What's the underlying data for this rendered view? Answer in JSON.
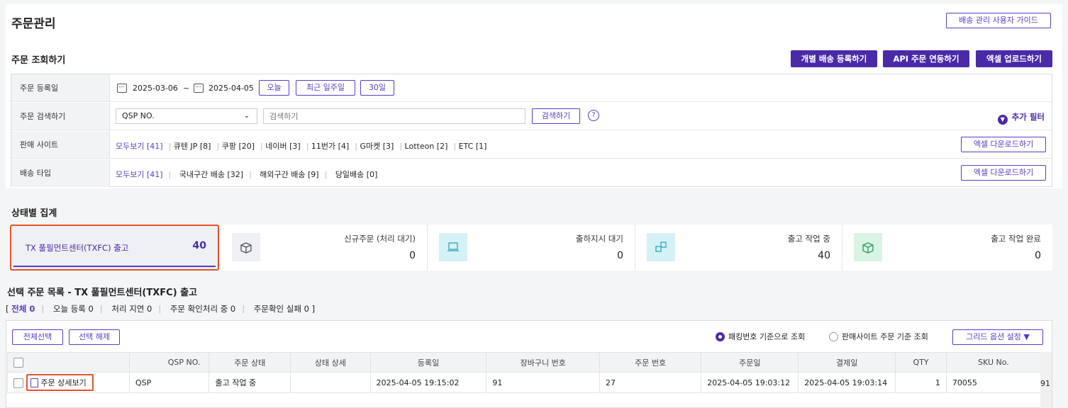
{
  "page": {
    "title": "주문관리",
    "guide_button": "배송 관리 사용자 가이드"
  },
  "search_section": {
    "title": "주문 조회하기",
    "buttons": [
      "개별 배송 등록하기",
      "API 주문 연동하기",
      "엑셀 업로드하기"
    ],
    "rows": {
      "date": {
        "label": "주문 등록일",
        "from": "2025-03-06",
        "sep": "~",
        "to": "2025-04-05",
        "quick": [
          "오늘",
          "최근 일주일",
          "30일"
        ]
      },
      "search": {
        "label": "주문 검색하기",
        "select_value": "QSP NO.",
        "placeholder": "검색하기",
        "button": "검색하기",
        "help": "?",
        "add_filter": "추가 필터"
      },
      "site": {
        "label": "판매 사이트",
        "items": [
          "모두보기 [41]",
          "큐텐 JP [8]",
          "쿠팡 [20]",
          "네이버 [3]",
          "11번가 [4]",
          "G마켓 [3]",
          "Lotteon [2]",
          "ETC [1]"
        ],
        "excel": "엑셀 다운로드하기"
      },
      "ship": {
        "label": "배송 타입",
        "items": [
          "모두보기 [41]",
          "국내구간 배송 [32]",
          "해외구간 배송 [9]",
          "당일배송 [0]"
        ],
        "excel": "엑셀 다운로드하기"
      }
    }
  },
  "status_section": {
    "title": "상태별 집계",
    "selected": {
      "label": "TX 풀필먼트센터(TXFC) 출고",
      "count": "40"
    },
    "cards": [
      {
        "label": "신규주문 (처리 대기)",
        "count": "0",
        "icon": "box-open-icon",
        "color": "#eef0f5"
      },
      {
        "label": "출하지시 대기",
        "count": "0",
        "icon": "laptop-icon",
        "color": "#d6f1f5"
      },
      {
        "label": "출고 작업 중",
        "count": "40",
        "icon": "boxes-icon",
        "color": "#d6f1f5"
      },
      {
        "label": "출고 작업 완료",
        "count": "0",
        "icon": "box-check-icon",
        "color": "#d9f3e4"
      }
    ]
  },
  "list_section": {
    "title": "선택 주문 목록 - TX 풀필먼트센터(TXFC) 출고",
    "tabs": {
      "open": "[",
      "close": "]",
      "items": [
        {
          "label": "전체",
          "count": "0"
        },
        {
          "label": "오늘 등록",
          "count": "0"
        },
        {
          "label": "처리 지연",
          "count": "0"
        },
        {
          "label": "주문 확인처리 중",
          "count": "0"
        },
        {
          "label": "주문확인 실패",
          "count": "0"
        }
      ]
    },
    "buttons": {
      "select_all": "전체선택",
      "deselect": "선택 해제",
      "grid_option": "그리드 옵션 설정 ▼"
    },
    "radios": [
      {
        "label": "패킹번호 기준으로 조회",
        "checked": true
      },
      {
        "label": "판매사이트 주문 기준 조회",
        "checked": false
      }
    ],
    "columns": [
      "",
      "QSP NO.",
      "주문 상태",
      "상태 상세",
      "등록일",
      "장바구니 번호",
      "주문 번호",
      "주문일",
      "결제일",
      "QTY",
      "SKU No."
    ],
    "rows": [
      {
        "detail": "주문 상세보기",
        "qsp": "QSP",
        "status": "출고 작업 중",
        "status_detail": "",
        "reg": "2025-04-05 19:15:02",
        "cart": "91",
        "order": "27",
        "order_date": "2025-04-05 19:03:12",
        "pay_date": "2025-04-05 19:03:14",
        "qty": "1",
        "sku": "70055",
        "extra": "91"
      }
    ]
  },
  "colors": {
    "accent": "#4b2aa8",
    "highlight": "#e2542a"
  }
}
